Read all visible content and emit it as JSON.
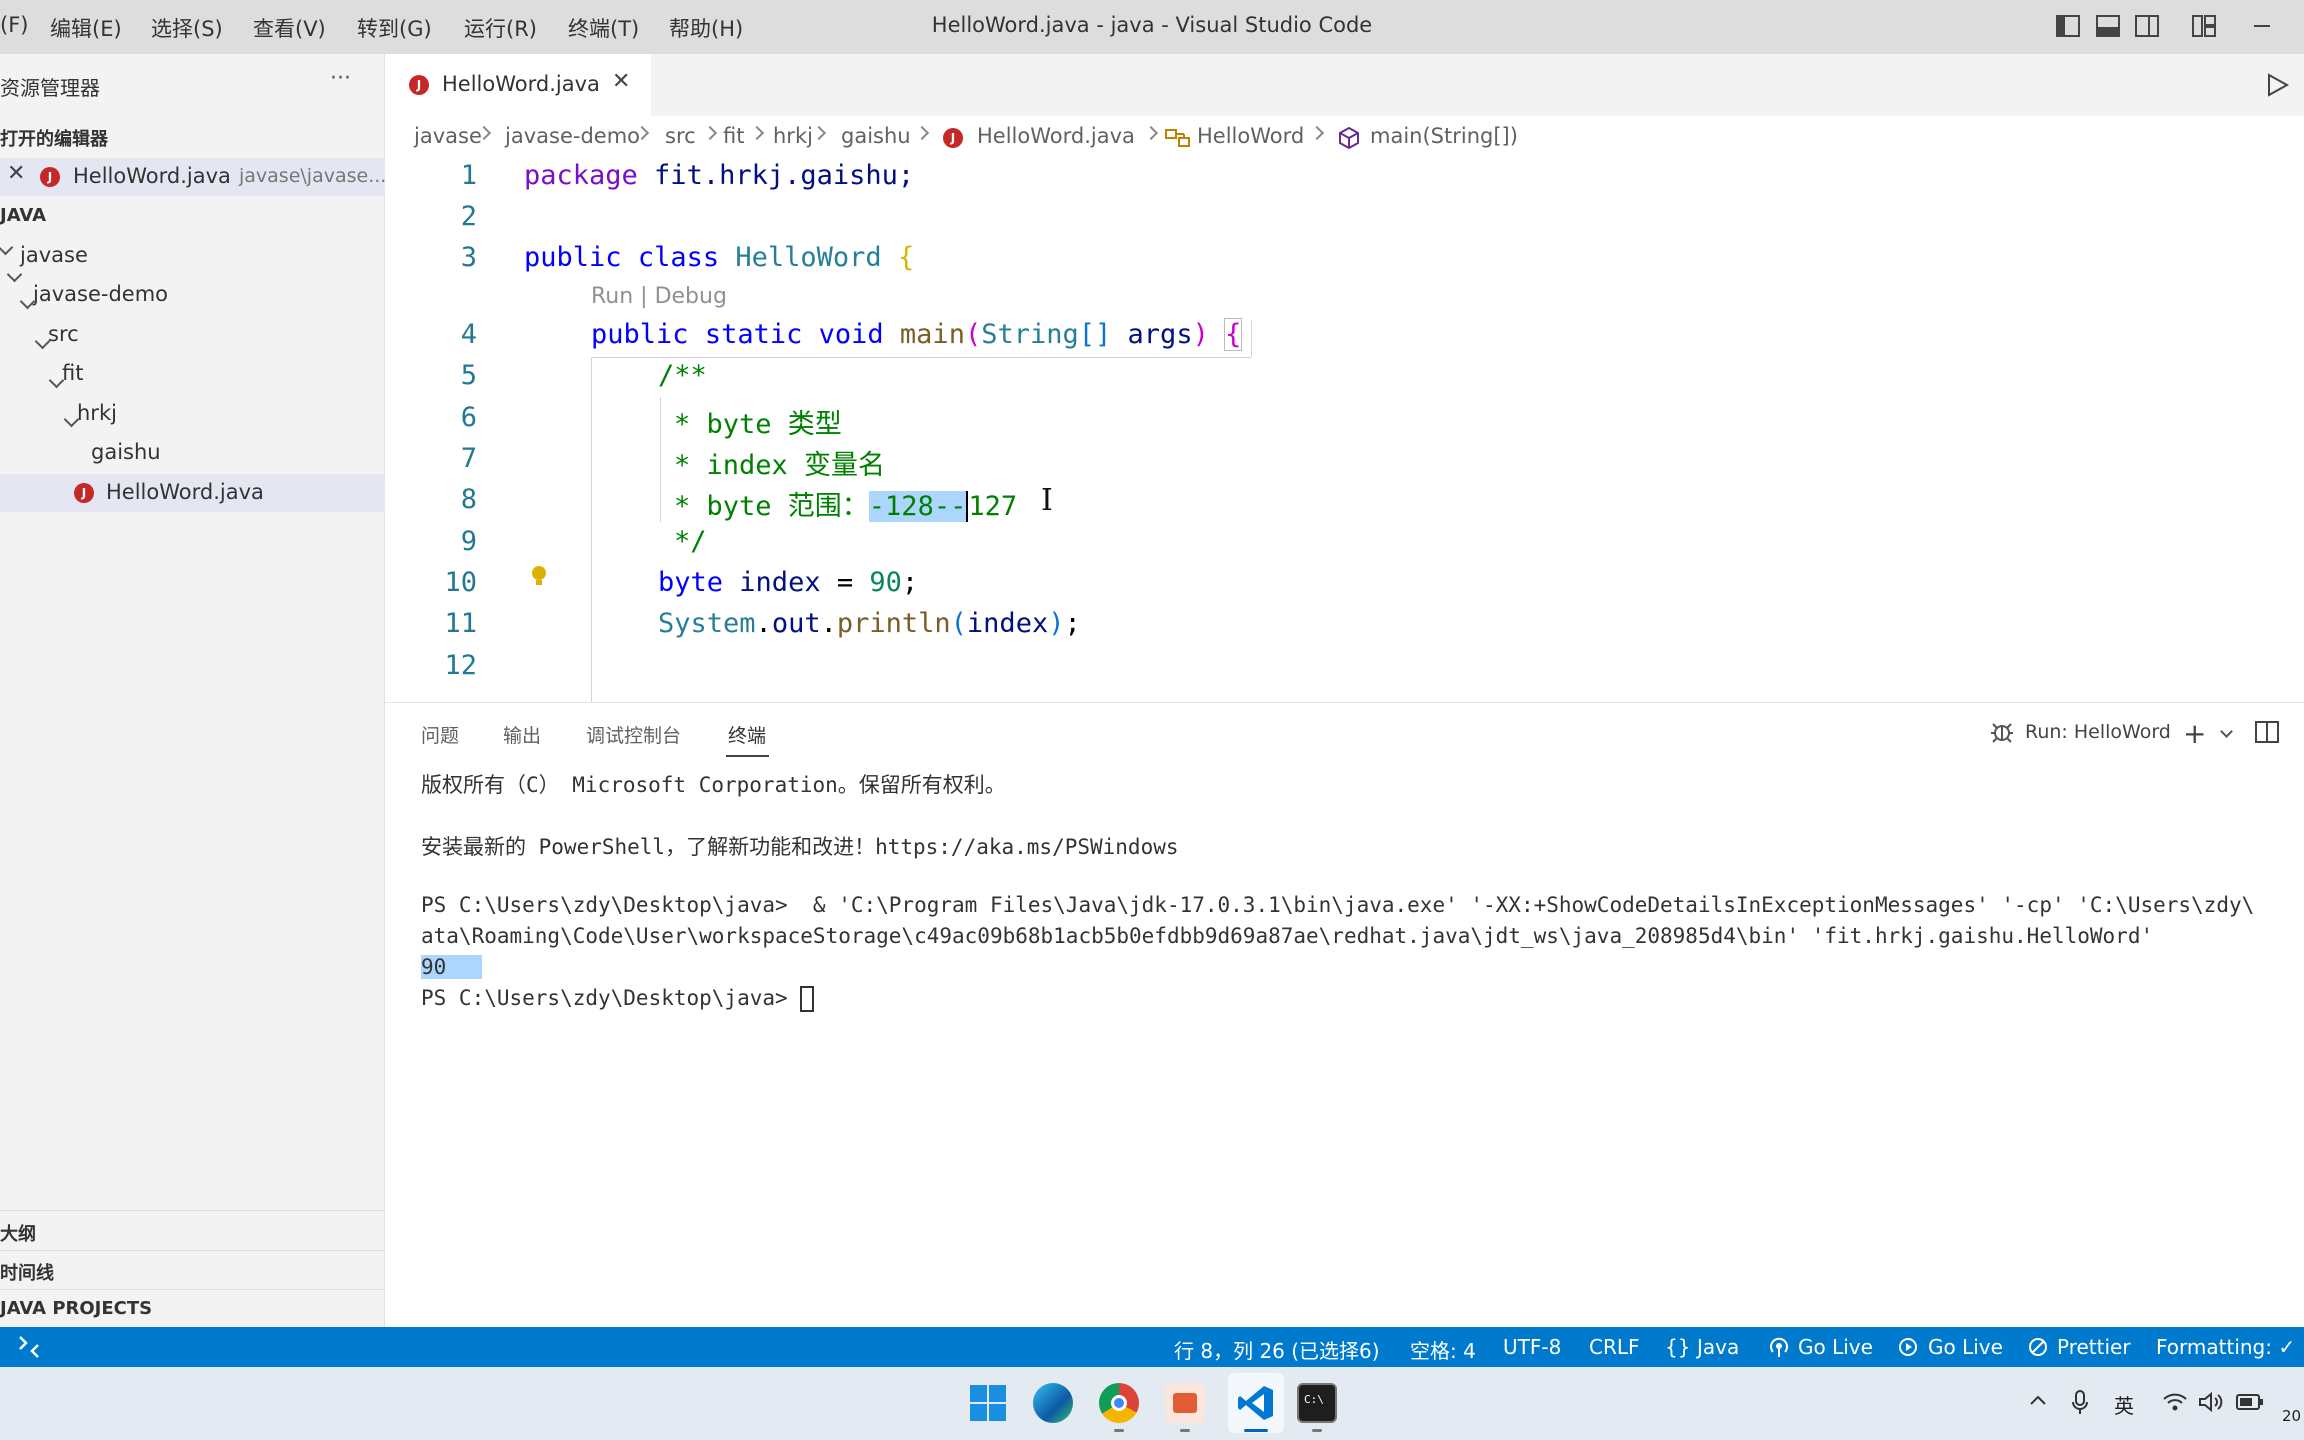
{
  "menu": [
    "(F)",
    "编辑(E)",
    "选择(S)",
    "查看(V)",
    "转到(G)",
    "运行(R)",
    "终端(T)",
    "帮助(H)"
  ],
  "window_title": "HelloWord.java - java - Visual Studio Code",
  "sidebar": {
    "title": "资源管理器",
    "more": "···",
    "open_editors_header": "打开的编辑器",
    "open_editor_file": "HelloWord.java",
    "open_editor_path": "javase\\javase...",
    "workspace_header": "JAVA",
    "tree": [
      "javase",
      "javase-demo",
      "src",
      "fit",
      "hrkj",
      "gaishu",
      "HelloWord.java"
    ],
    "outline": "大纲",
    "timeline": "时间线",
    "java_projects": "JAVA PROJECTS"
  },
  "tab": {
    "label": "HelloWord.java",
    "badge": "J",
    "close": "✕"
  },
  "breadcrumb": [
    "javase",
    "javase-demo",
    "src",
    "fit",
    "hrkj",
    "gaishu",
    "HelloWord.java",
    "HelloWord",
    "main(String[])"
  ],
  "code": {
    "line_numbers": [
      "1",
      "2",
      "3",
      "4",
      "5",
      "6",
      "7",
      "8",
      "9",
      "10",
      "11",
      "12"
    ],
    "codelens": "Run | Debug",
    "l1": {
      "kw": "package",
      "rest": " fit.hrkj.gaishu;"
    },
    "l3": {
      "kw1": "public",
      "kw2": "class",
      "cls": "HelloWord",
      "brace": "{"
    },
    "l4": {
      "kw1": "public",
      "kw2": "static",
      "kw3": "void",
      "fn": "main",
      "p1": "(",
      "cls": "String",
      "brk": "[]",
      "arg": "args",
      "p2": ")",
      "brace": "{"
    },
    "l5": "/**",
    "l6": "* byte 类型",
    "l7": "* index 变量名",
    "l8_pre": "* byte 范围：",
    "l8_sel": "-128--",
    "l8_post": "127",
    "l9": "*/",
    "l10": {
      "kw": "byte",
      "var": "index",
      "eq": " = ",
      "num": "90",
      "semi": ";"
    },
    "l11": {
      "cls": "System",
      "dot1": ".",
      "var": "out",
      "dot2": ".",
      "fn": "println",
      "p1": "(",
      "arg": "index",
      "p2": ")",
      "semi": ";"
    }
  },
  "panel": {
    "tabs": [
      "问题",
      "输出",
      "调试控制台",
      "终端"
    ],
    "run_label": "Run: HelloWord",
    "terminal_lines": [
      "版权所有（C） Microsoft Corporation。保留所有权利。",
      "安装最新的 PowerShell，了解新功能和改进！https://aka.ms/PSWindows",
      "PS C:\\Users\\zdy\\Desktop\\java>  & 'C:\\Program Files\\Java\\jdk-17.0.3.1\\bin\\java.exe' '-XX:+ShowCodeDetailsInExceptionMessages' '-cp' 'C:\\Users\\zdy\\",
      "ata\\Roaming\\Code\\User\\workspaceStorage\\c49ac09b68b1acb5b0efdbb9d69a87ae\\redhat.java\\jdt_ws\\java_208985d4\\bin' 'fit.hrkj.gaishu.HelloWord'",
      "90",
      "PS C:\\Users\\zdy\\Desktop\\java>"
    ]
  },
  "status": {
    "position": "行 8，列 26 (已选择6)",
    "spaces": "空格: 4",
    "encoding": "UTF-8",
    "eol": "CRLF",
    "language": "Java",
    "golive1": "Go Live",
    "golive2": "Go Live",
    "prettier": "Prettier",
    "formatting": "Formatting: ✓"
  },
  "taskbar": {
    "ime": "英",
    "clock_partial": "20"
  },
  "colors": {
    "statusbar": "#007acc",
    "java_badge": "#c62828",
    "selection": "#add6ff"
  }
}
